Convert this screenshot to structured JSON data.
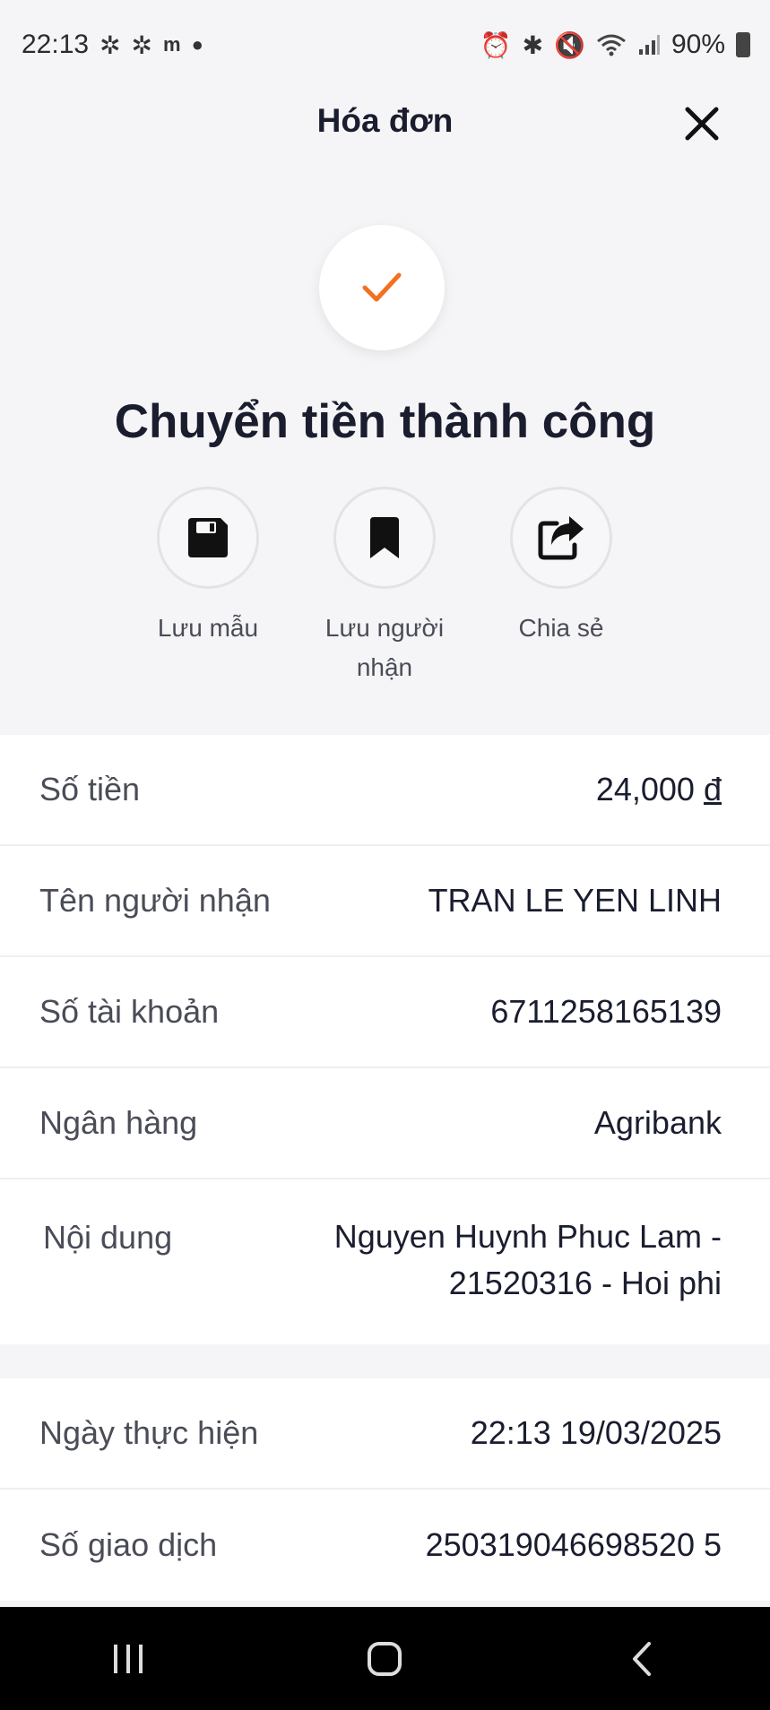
{
  "status_bar": {
    "time": "22:13",
    "battery": "90%",
    "left_icons": [
      "pinwheel-icon",
      "pinwheel-icon",
      "momo-icon",
      "dot-icon"
    ],
    "right_icons": [
      "alarm-icon",
      "bluetooth-icon",
      "mute-icon",
      "wifi-icon",
      "signal-icon",
      "battery-icon"
    ]
  },
  "header": {
    "title": "Hóa đơn",
    "close_icon": "close-icon"
  },
  "success": {
    "icon": "checkmark-icon",
    "title": "Chuyển tiền thành công",
    "accent_color": "#f37021"
  },
  "actions": [
    {
      "label": "Lưu mẫu",
      "icon": "save-icon"
    },
    {
      "label": "Lưu người nhận",
      "icon": "bookmark-icon"
    },
    {
      "label": "Chia sẻ",
      "icon": "share-icon"
    }
  ],
  "details": {
    "amount": {
      "label": "Số tiền",
      "value": "24,000",
      "currency": "đ"
    },
    "recipient": {
      "label": "Tên người nhận",
      "value": "TRAN LE YEN LINH"
    },
    "account": {
      "label": "Số tài khoản",
      "value": "6711258165139"
    },
    "bank": {
      "label": "Ngân hàng",
      "value": "Agribank"
    },
    "content": {
      "label": "Nội dung",
      "value": "Nguyen Huynh Phuc Lam - 21520316 - Hoi phi"
    }
  },
  "transaction": {
    "date": {
      "label": "Ngày thực hiện",
      "value": "22:13 19/03/2025"
    },
    "id": {
      "label": "Số giao dịch",
      "value": "250319046698520 5"
    }
  },
  "nav": {
    "recent_icon": "recent-apps-icon",
    "home_icon": "home-icon",
    "back_icon": "back-icon"
  }
}
